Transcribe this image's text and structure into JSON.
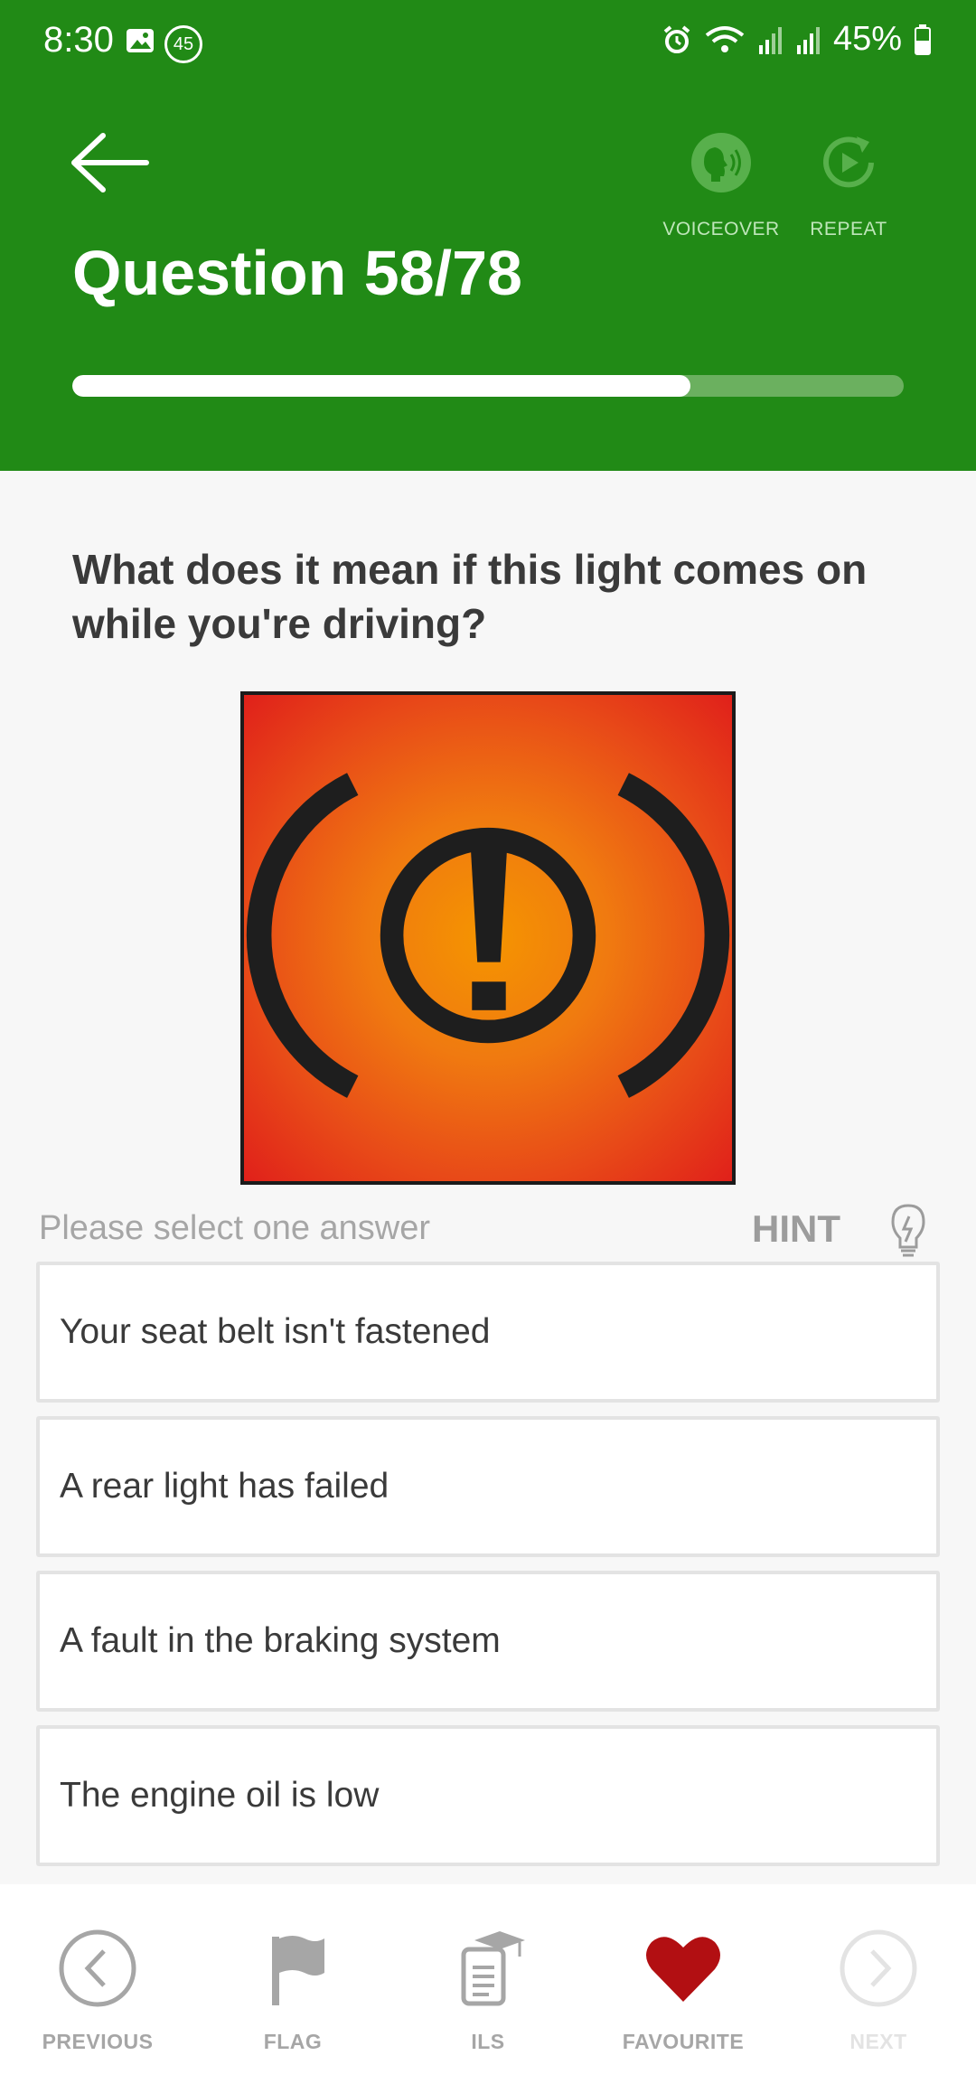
{
  "status_bar": {
    "time": "8:30",
    "notification_badge": "45",
    "battery": "45%",
    "icons": [
      "image-icon",
      "alarm-icon",
      "wifi-icon",
      "signal-icon",
      "signal-icon",
      "battery-icon"
    ]
  },
  "header": {
    "title": "Question 58/78",
    "voiceover_label": "VOICEOVER",
    "repeat_label": "REPEAT",
    "progress_fraction": 0.744,
    "color": "#218a16"
  },
  "question": {
    "text": "What does it mean if this light comes on while you're driving?",
    "image_icon": "brake-warning-light-icon"
  },
  "answers_section": {
    "prompt": "Please select one answer",
    "hint_label": "HINT",
    "options": [
      "Your seat belt isn't fastened",
      "A rear light has failed",
      "A fault in the braking system",
      "The engine oil is low"
    ]
  },
  "bottom_nav": {
    "previous": "PREVIOUS",
    "flag": "FLAG",
    "ils": "ILS",
    "favourite": "FAVOURITE",
    "next": "NEXT",
    "favourite_color": "#b20f12"
  }
}
